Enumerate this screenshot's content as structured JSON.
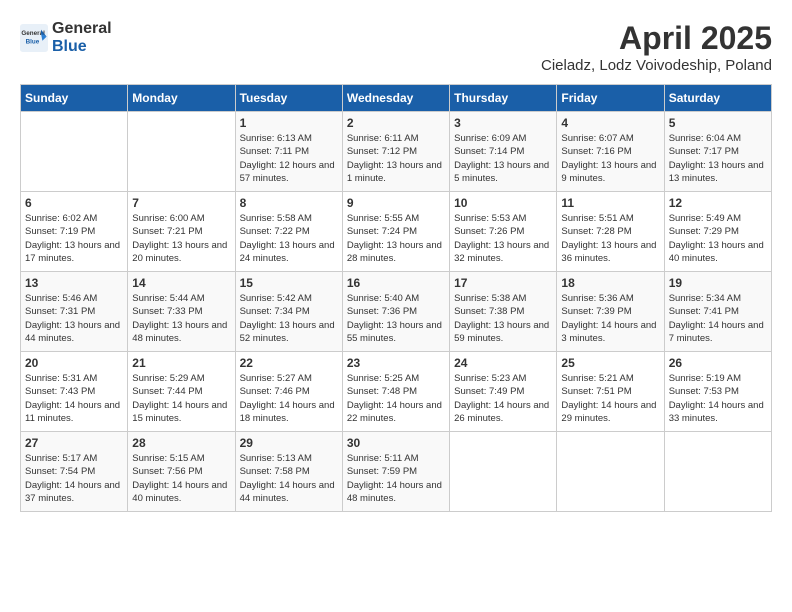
{
  "header": {
    "logo_general": "General",
    "logo_blue": "Blue",
    "month_title": "April 2025",
    "location": "Cieladz, Lodz Voivodeship, Poland"
  },
  "days_of_week": [
    "Sunday",
    "Monday",
    "Tuesday",
    "Wednesday",
    "Thursday",
    "Friday",
    "Saturday"
  ],
  "weeks": [
    [
      {
        "day": "",
        "info": ""
      },
      {
        "day": "",
        "info": ""
      },
      {
        "day": "1",
        "info": "Sunrise: 6:13 AM\nSunset: 7:11 PM\nDaylight: 12 hours and 57 minutes."
      },
      {
        "day": "2",
        "info": "Sunrise: 6:11 AM\nSunset: 7:12 PM\nDaylight: 13 hours and 1 minute."
      },
      {
        "day": "3",
        "info": "Sunrise: 6:09 AM\nSunset: 7:14 PM\nDaylight: 13 hours and 5 minutes."
      },
      {
        "day": "4",
        "info": "Sunrise: 6:07 AM\nSunset: 7:16 PM\nDaylight: 13 hours and 9 minutes."
      },
      {
        "day": "5",
        "info": "Sunrise: 6:04 AM\nSunset: 7:17 PM\nDaylight: 13 hours and 13 minutes."
      }
    ],
    [
      {
        "day": "6",
        "info": "Sunrise: 6:02 AM\nSunset: 7:19 PM\nDaylight: 13 hours and 17 minutes."
      },
      {
        "day": "7",
        "info": "Sunrise: 6:00 AM\nSunset: 7:21 PM\nDaylight: 13 hours and 20 minutes."
      },
      {
        "day": "8",
        "info": "Sunrise: 5:58 AM\nSunset: 7:22 PM\nDaylight: 13 hours and 24 minutes."
      },
      {
        "day": "9",
        "info": "Sunrise: 5:55 AM\nSunset: 7:24 PM\nDaylight: 13 hours and 28 minutes."
      },
      {
        "day": "10",
        "info": "Sunrise: 5:53 AM\nSunset: 7:26 PM\nDaylight: 13 hours and 32 minutes."
      },
      {
        "day": "11",
        "info": "Sunrise: 5:51 AM\nSunset: 7:28 PM\nDaylight: 13 hours and 36 minutes."
      },
      {
        "day": "12",
        "info": "Sunrise: 5:49 AM\nSunset: 7:29 PM\nDaylight: 13 hours and 40 minutes."
      }
    ],
    [
      {
        "day": "13",
        "info": "Sunrise: 5:46 AM\nSunset: 7:31 PM\nDaylight: 13 hours and 44 minutes."
      },
      {
        "day": "14",
        "info": "Sunrise: 5:44 AM\nSunset: 7:33 PM\nDaylight: 13 hours and 48 minutes."
      },
      {
        "day": "15",
        "info": "Sunrise: 5:42 AM\nSunset: 7:34 PM\nDaylight: 13 hours and 52 minutes."
      },
      {
        "day": "16",
        "info": "Sunrise: 5:40 AM\nSunset: 7:36 PM\nDaylight: 13 hours and 55 minutes."
      },
      {
        "day": "17",
        "info": "Sunrise: 5:38 AM\nSunset: 7:38 PM\nDaylight: 13 hours and 59 minutes."
      },
      {
        "day": "18",
        "info": "Sunrise: 5:36 AM\nSunset: 7:39 PM\nDaylight: 14 hours and 3 minutes."
      },
      {
        "day": "19",
        "info": "Sunrise: 5:34 AM\nSunset: 7:41 PM\nDaylight: 14 hours and 7 minutes."
      }
    ],
    [
      {
        "day": "20",
        "info": "Sunrise: 5:31 AM\nSunset: 7:43 PM\nDaylight: 14 hours and 11 minutes."
      },
      {
        "day": "21",
        "info": "Sunrise: 5:29 AM\nSunset: 7:44 PM\nDaylight: 14 hours and 15 minutes."
      },
      {
        "day": "22",
        "info": "Sunrise: 5:27 AM\nSunset: 7:46 PM\nDaylight: 14 hours and 18 minutes."
      },
      {
        "day": "23",
        "info": "Sunrise: 5:25 AM\nSunset: 7:48 PM\nDaylight: 14 hours and 22 minutes."
      },
      {
        "day": "24",
        "info": "Sunrise: 5:23 AM\nSunset: 7:49 PM\nDaylight: 14 hours and 26 minutes."
      },
      {
        "day": "25",
        "info": "Sunrise: 5:21 AM\nSunset: 7:51 PM\nDaylight: 14 hours and 29 minutes."
      },
      {
        "day": "26",
        "info": "Sunrise: 5:19 AM\nSunset: 7:53 PM\nDaylight: 14 hours and 33 minutes."
      }
    ],
    [
      {
        "day": "27",
        "info": "Sunrise: 5:17 AM\nSunset: 7:54 PM\nDaylight: 14 hours and 37 minutes."
      },
      {
        "day": "28",
        "info": "Sunrise: 5:15 AM\nSunset: 7:56 PM\nDaylight: 14 hours and 40 minutes."
      },
      {
        "day": "29",
        "info": "Sunrise: 5:13 AM\nSunset: 7:58 PM\nDaylight: 14 hours and 44 minutes."
      },
      {
        "day": "30",
        "info": "Sunrise: 5:11 AM\nSunset: 7:59 PM\nDaylight: 14 hours and 48 minutes."
      },
      {
        "day": "",
        "info": ""
      },
      {
        "day": "",
        "info": ""
      },
      {
        "day": "",
        "info": ""
      }
    ]
  ]
}
